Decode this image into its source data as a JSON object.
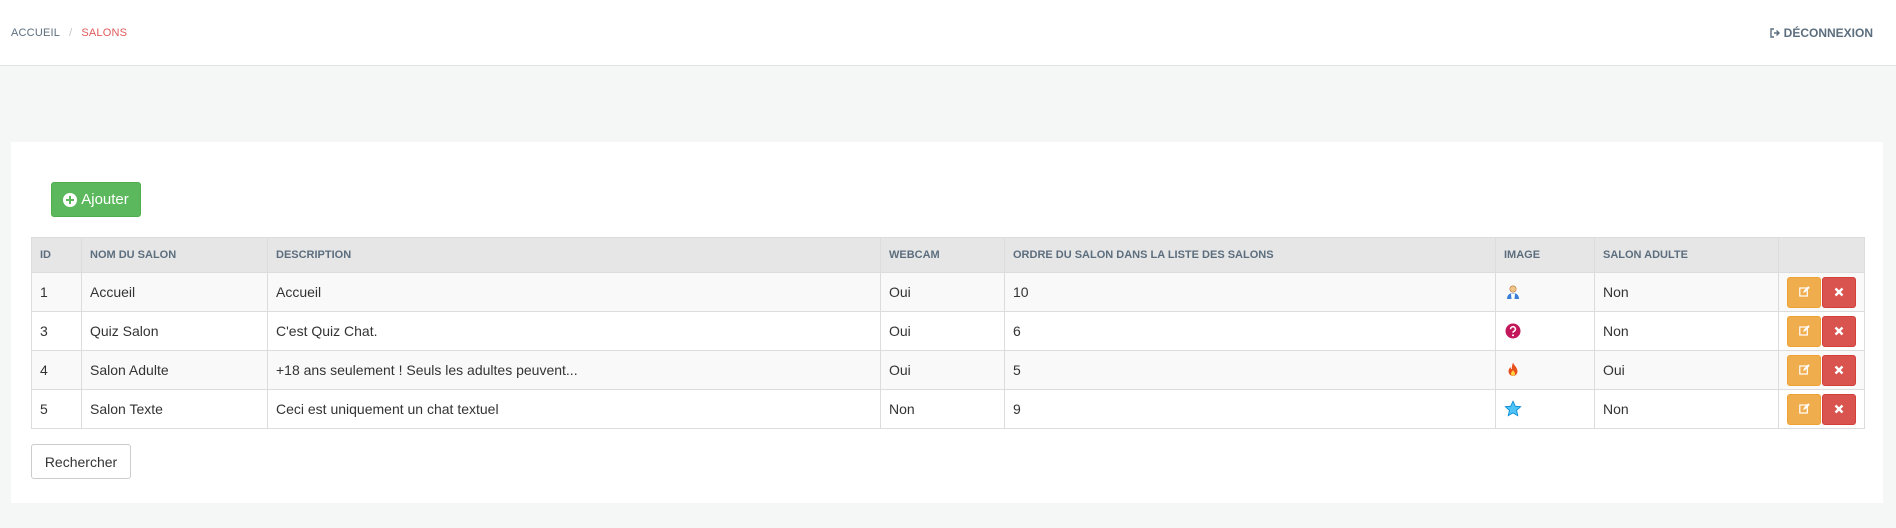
{
  "breadcrumb": {
    "home": "ACCUEIL",
    "separator": "/",
    "current": "SALONS"
  },
  "logout": {
    "label": "DÉCONNEXION",
    "icon": "sign-out-icon"
  },
  "toolbar": {
    "add_label": "Ajouter",
    "add_icon": "plus-circle-icon"
  },
  "table": {
    "headers": [
      "ID",
      "NOM DU SALON",
      "DESCRIPTION",
      "WEBCAM",
      "ORDRE DU SALON DANS LA LISTE DES SALONS",
      "IMAGE",
      "SALON ADULTE",
      ""
    ],
    "rows": [
      {
        "id": "1",
        "name": "Accueil",
        "description": "Accueil",
        "webcam": "Oui",
        "order": "10",
        "image": "user-icon",
        "adult": "Non"
      },
      {
        "id": "3",
        "name": "Quiz Salon",
        "description": "C'est Quiz Chat.",
        "webcam": "Oui",
        "order": "6",
        "image": "question-icon",
        "adult": "Non"
      },
      {
        "id": "4",
        "name": "Salon Adulte",
        "description": "+18 ans seulement ! Seuls les adultes peuvent...",
        "webcam": "Oui",
        "order": "5",
        "image": "flame-icon",
        "adult": "Oui"
      },
      {
        "id": "5",
        "name": "Salon Texte",
        "description": "Ceci est uniquement un chat textuel",
        "webcam": "Non",
        "order": "9",
        "image": "star-icon",
        "adult": "Non"
      }
    ]
  },
  "search": {
    "label": "Rechercher"
  },
  "colors": {
    "add": "#5cb85c",
    "edit": "#f0ad4e",
    "delete": "#d9534f",
    "breadcrumb_active": "#e15b5b"
  }
}
